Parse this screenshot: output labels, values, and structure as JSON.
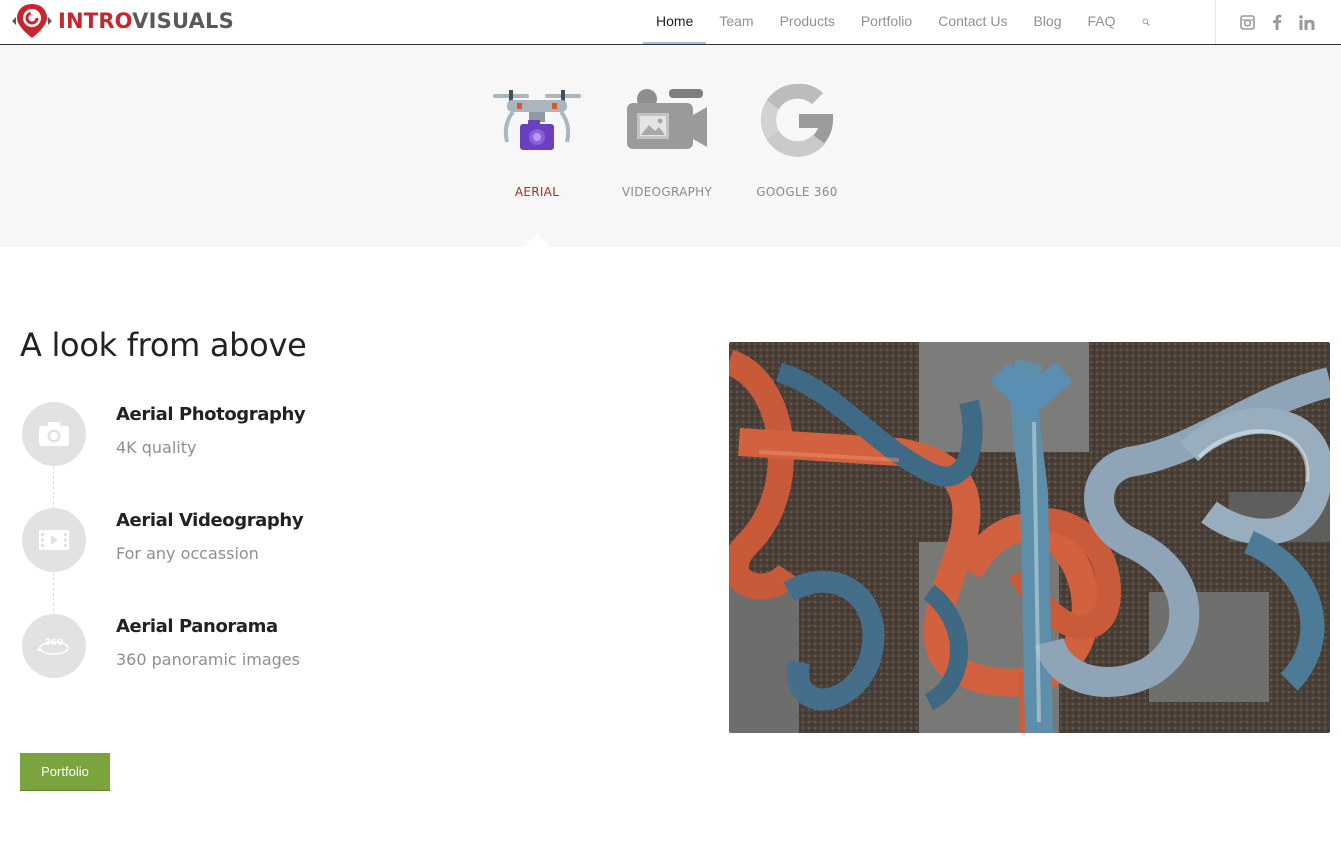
{
  "brand": {
    "name_part1": "INTRO",
    "name_part2": "VISUALS",
    "colors": {
      "red": "#c6262e",
      "gray": "#58595b"
    }
  },
  "nav": {
    "items": [
      {
        "label": "Home",
        "active": true
      },
      {
        "label": "Team"
      },
      {
        "label": "Products"
      },
      {
        "label": "Portfolio"
      },
      {
        "label": "Contact Us"
      },
      {
        "label": "Blog"
      },
      {
        "label": "FAQ"
      }
    ],
    "search_icon": "search-icon",
    "social": [
      "instagram-icon",
      "facebook-icon",
      "linkedin-icon"
    ]
  },
  "tabs": [
    {
      "label": "AERIAL",
      "icon": "drone-camera-icon",
      "active": true
    },
    {
      "label": "VIDEOGRAPHY",
      "icon": "video-camera-icon"
    },
    {
      "label": "GOOGLE 360",
      "icon": "google-icon"
    }
  ],
  "section": {
    "heading": "A look from above",
    "features": [
      {
        "title": "Aerial Photography",
        "subtitle": "4K quality",
        "icon": "camera-icon"
      },
      {
        "title": "Aerial Videography",
        "subtitle": "For any occassion",
        "icon": "film-icon"
      },
      {
        "title": "Aerial Panorama",
        "subtitle": "360 panoramic images",
        "icon": "panorama-360-icon"
      }
    ],
    "button_label": "Portfolio",
    "button_color": "#7ba33e",
    "image": "aerial-waterslides-photo"
  },
  "icons": {
    "panorama_label": "360"
  }
}
